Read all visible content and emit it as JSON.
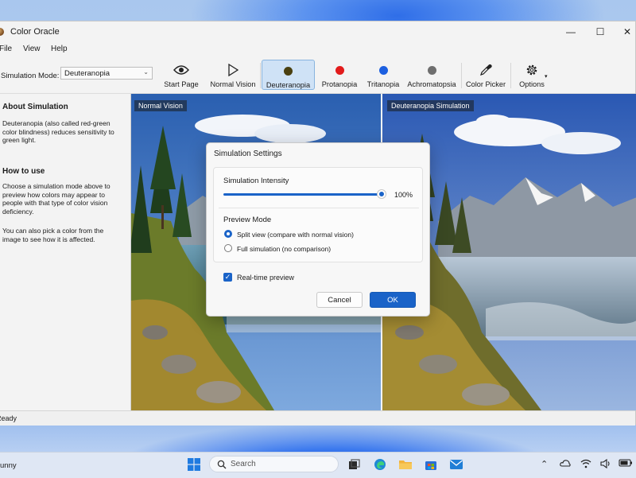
{
  "window": {
    "title": "Color Oracle",
    "controls": {
      "minimize": "—",
      "maximize": "☐",
      "close": "✕"
    }
  },
  "menu": [
    "File",
    "View",
    "Help"
  ],
  "toolbar": {
    "simulation_label": "Simulation Mode:",
    "simulation_value": "Deuteranopia",
    "buttons": [
      {
        "label": "Start Page",
        "icon": "eye-icon"
      },
      {
        "label": "Normal Vision",
        "icon": "play-icon"
      },
      {
        "label": "Deuteranopia",
        "icon": "circle-icon",
        "color": "#4a4010",
        "active": true
      },
      {
        "label": "Protanopia",
        "icon": "circle-icon",
        "color": "#e21b1b"
      },
      {
        "label": "Tritanopia",
        "icon": "circle-icon",
        "color": "#1c5fe0"
      },
      {
        "label": "Achromatopsia",
        "icon": "circle-icon",
        "color": "#6e6e6e"
      },
      {
        "label": "Color Picker",
        "icon": "eyedropper-icon"
      },
      {
        "label": "Options",
        "icon": "gear-icon"
      }
    ]
  },
  "sidebar": {
    "about_heading": "About Simulation",
    "about_text": "Deuteranopia (also called red-green color blindness) reduces sensitivity to green light.",
    "howto_heading": "How to use",
    "howto_text_1": "Choose a simulation mode above to preview how colors may appear to people with that type of color vision deficiency.",
    "howto_text_2": "You can also pick a color from the image to see how it is affected."
  },
  "panes": {
    "left_label": "Normal Vision",
    "right_label": "Deuteranopia Simulation"
  },
  "status": "Ready",
  "dialog": {
    "title": "Simulation Settings",
    "intensity_label": "Simulation Intensity",
    "intensity_value": "100%",
    "intensity_fraction": 1.0,
    "preview_mode_label": "Preview Mode",
    "options": [
      {
        "label": "Split view (compare with normal vision)",
        "selected": true
      },
      {
        "label": "Full simulation (no comparison)",
        "selected": false
      }
    ],
    "realtime_label": "Real-time preview",
    "realtime_checked": true,
    "cancel_label": "Cancel",
    "ok_label": "OK"
  },
  "taskbar": {
    "left_text": "unny",
    "search_placeholder": "Search",
    "apps": [
      "windows-start-icon",
      "task-view-icon",
      "edge-icon",
      "file-explorer-icon",
      "store-icon",
      "mail-icon"
    ],
    "tray": [
      "chevron-up-icon",
      "cloud-icon",
      "wifi-icon",
      "volume-icon",
      "battery-icon"
    ]
  },
  "colors": {
    "accent": "#1a63c8",
    "active_toolbar_bg": "#cfe2f6"
  }
}
